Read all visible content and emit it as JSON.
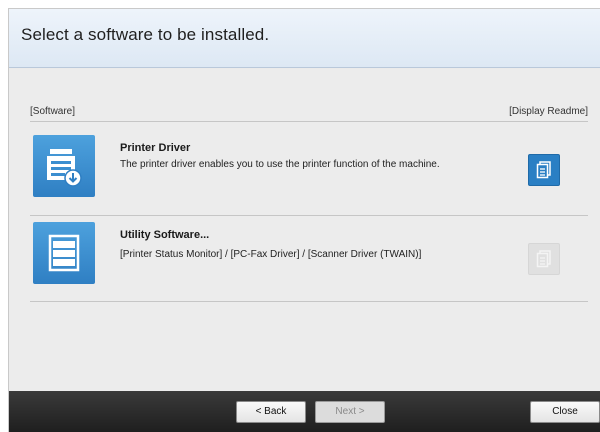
{
  "header": {
    "title": "Select a software to be installed."
  },
  "columns": {
    "software": "[Software]",
    "readme": "[Display Readme]"
  },
  "software": [
    {
      "name": "Printer Driver",
      "description": "The printer driver enables you to use the printer function of the machine.",
      "icon": "printer-driver-icon",
      "readme_enabled": true
    },
    {
      "name": "Utility Software...",
      "description": "[Printer Status Monitor] / [PC-Fax Driver] / [Scanner Driver (TWAIN)]",
      "icon": "utility-software-icon",
      "readme_enabled": false
    }
  ],
  "footer": {
    "back": "< Back",
    "next": "Next >",
    "close": "Close"
  },
  "colors": {
    "accent": "#2a7fc4",
    "footer": "#2b2b2b",
    "header": "#e6eef8"
  }
}
